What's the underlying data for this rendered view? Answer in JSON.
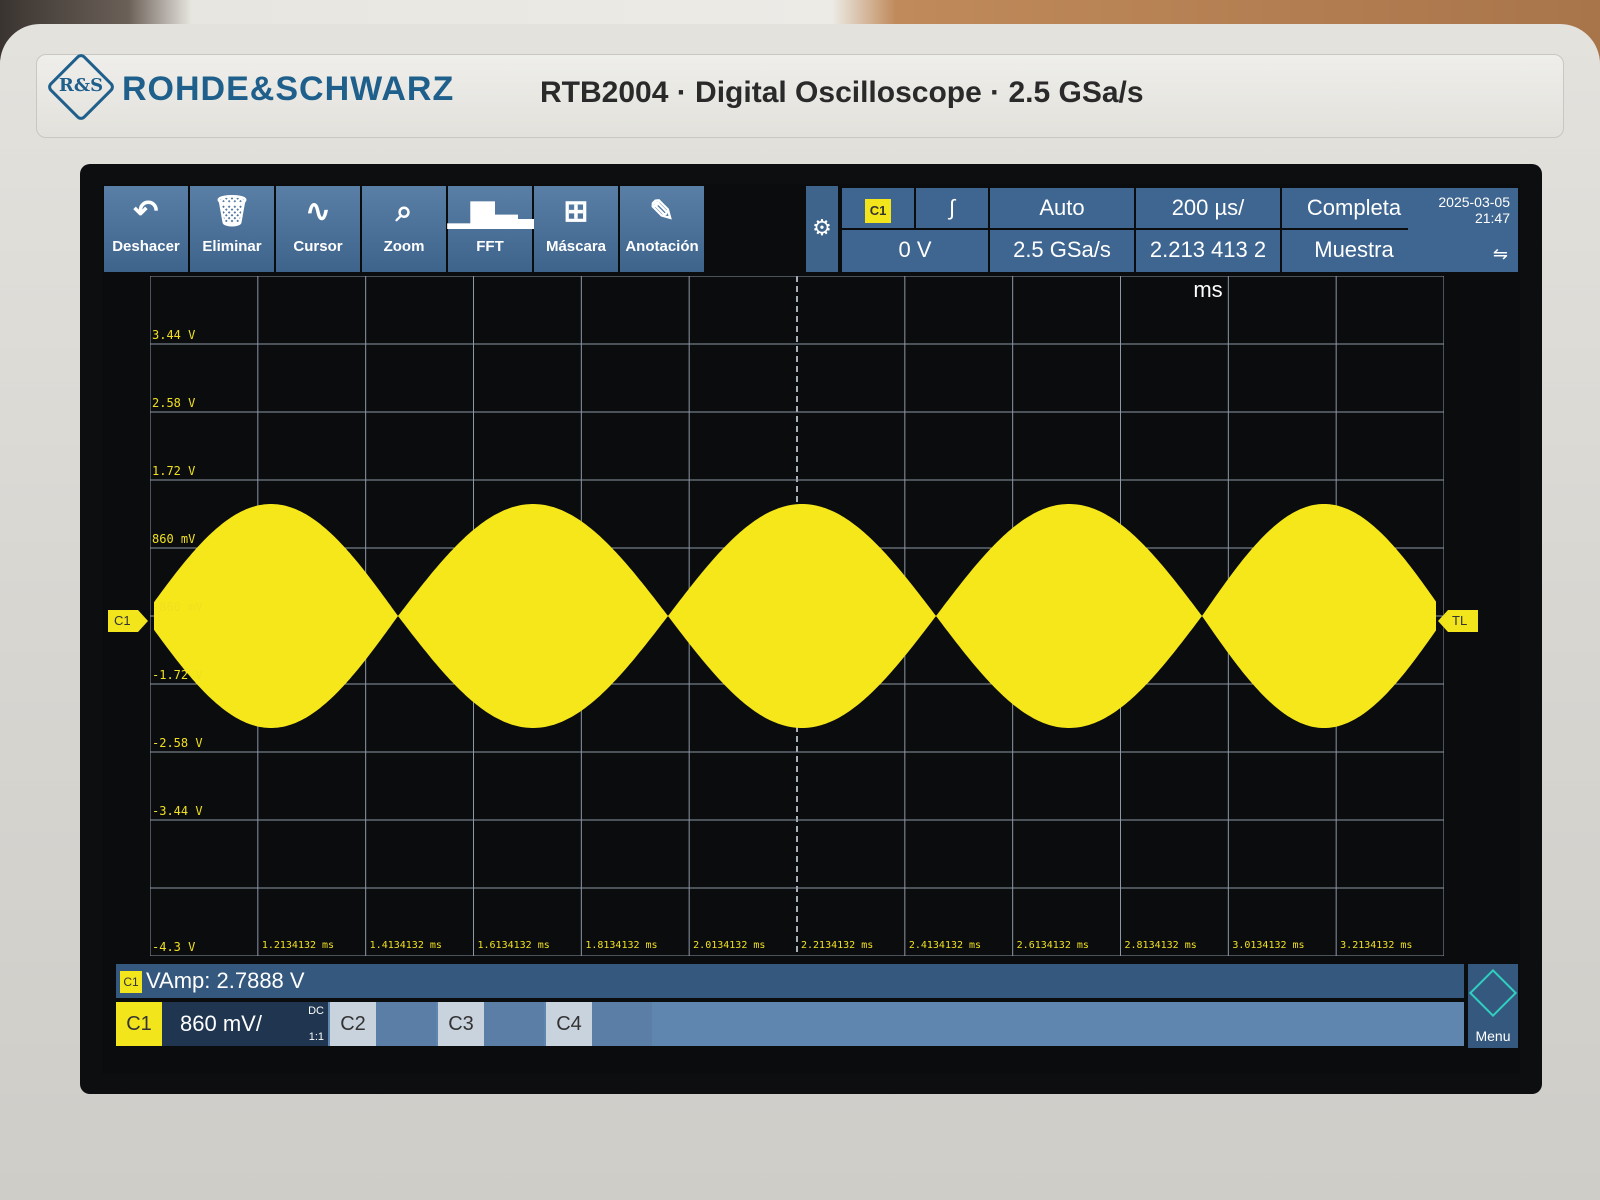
{
  "brand": {
    "name": "ROHDE&SCHWARZ",
    "logo_text": "R&S",
    "model_line": "RTB2004 · Digital Oscilloscope · 2.5 GSa/s"
  },
  "toolbar": {
    "undo": {
      "label": "Deshacer",
      "icon": "undo-arrow-icon"
    },
    "delete": {
      "label": "Eliminar",
      "icon": "trash-icon"
    },
    "cursor": {
      "label": "Cursor",
      "icon": "cursor-wave-icon"
    },
    "zoom": {
      "label": "Zoom",
      "icon": "magnifier-icon"
    },
    "fft": {
      "label": "FFT",
      "icon": "fft-bars-icon"
    },
    "mask": {
      "label": "Máscara",
      "icon": "mask-icon"
    },
    "annotation": {
      "label": "Anotación",
      "icon": "pencil-icon"
    }
  },
  "trigger": {
    "source": "C1",
    "slope_icon": "rising-edge-icon",
    "level": "0 V",
    "mode": "Auto",
    "sample_rate": "2.5 GSa/s",
    "timebase": "200 µs/",
    "position": "2.213 413 2 ms",
    "acquisition": "Completa",
    "sample_mode": "Muestra"
  },
  "datetime": {
    "date": "2025-03-05",
    "time": "21:47"
  },
  "grid": {
    "y_labels": [
      "3.44 V",
      "2.58 V",
      "1.72 V",
      "860 mV",
      "-860 mV",
      "-1.72 V",
      "-2.58 V",
      "-3.44 V",
      "-4.3 V"
    ],
    "x_labels": [
      "1.2134132 ms",
      "1.4134132 ms",
      "1.6134132 ms",
      "1.8134132 ms",
      "2.0134132 ms",
      "2.2134132 ms",
      "2.4134132 ms",
      "2.6134132 ms",
      "2.8134132 ms",
      "3.0134132 ms",
      "3.2134132 ms"
    ],
    "channel_marker": "C1",
    "trigger_marker": "TL",
    "trace_color": "#f5e71a"
  },
  "measurement": {
    "channel": "C1",
    "text": "VAmp: 2.7888 V"
  },
  "channels": {
    "c1": {
      "label": "C1",
      "scale": "860 mV/",
      "coupling": "DC",
      "probe": "1:1"
    },
    "c2": {
      "label": "C2"
    },
    "c3": {
      "label": "C3"
    },
    "c4": {
      "label": "C4"
    }
  },
  "menu": {
    "label": "Menu"
  }
}
